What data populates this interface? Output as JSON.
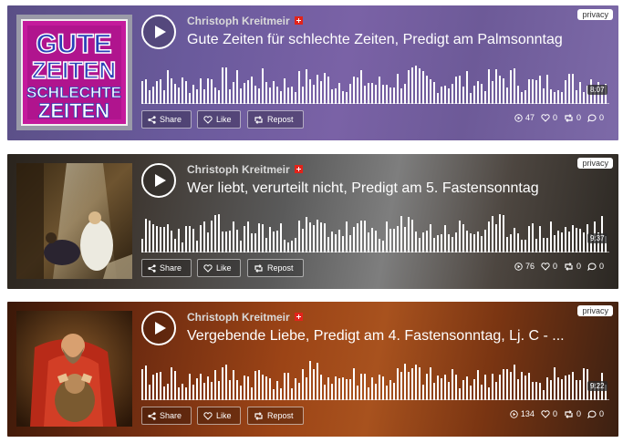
{
  "players": [
    {
      "artist": "Christoph Kreitmeir",
      "title": "Gute Zeiten für schlechte Zeiten, Predigt am Palmsonntag",
      "privacy_label": "privacy",
      "duration": "8:07",
      "artwork_text": [
        "GUTE",
        "ZEITEN",
        "SCHLECHTE",
        "ZEITEN"
      ],
      "buttons": {
        "share": "Share",
        "like": "Like",
        "repost": "Repost"
      },
      "stats": {
        "plays": "47",
        "likes": "0",
        "reposts": "0",
        "comments": "0"
      }
    },
    {
      "artist": "Christoph Kreitmeir",
      "title": "Wer liebt, verurteilt nicht, Predigt am 5. Fastensonntag",
      "privacy_label": "privacy",
      "duration": "9:37",
      "buttons": {
        "share": "Share",
        "like": "Like",
        "repost": "Repost"
      },
      "stats": {
        "plays": "76",
        "likes": "0",
        "reposts": "0",
        "comments": "0"
      }
    },
    {
      "artist": "Christoph Kreitmeir",
      "title": "Vergebende Liebe, Predigt am 4. Fastensonntag, Lj. C - ...",
      "privacy_label": "privacy",
      "duration": "9:22",
      "buttons": {
        "share": "Share",
        "like": "Like",
        "repost": "Repost"
      },
      "stats": {
        "plays": "134",
        "likes": "0",
        "reposts": "0",
        "comments": "0"
      }
    }
  ],
  "icons": [
    "play-icon",
    "share-icon",
    "heart-icon",
    "repost-icon",
    "play-count-icon",
    "comment-icon",
    "swiss-flag-icon"
  ],
  "colors": {
    "accent": "#ffffff",
    "flag": "#e2231a",
    "logo_magenta": "#c0169a",
    "logo_blue": "#2a3fb8"
  }
}
